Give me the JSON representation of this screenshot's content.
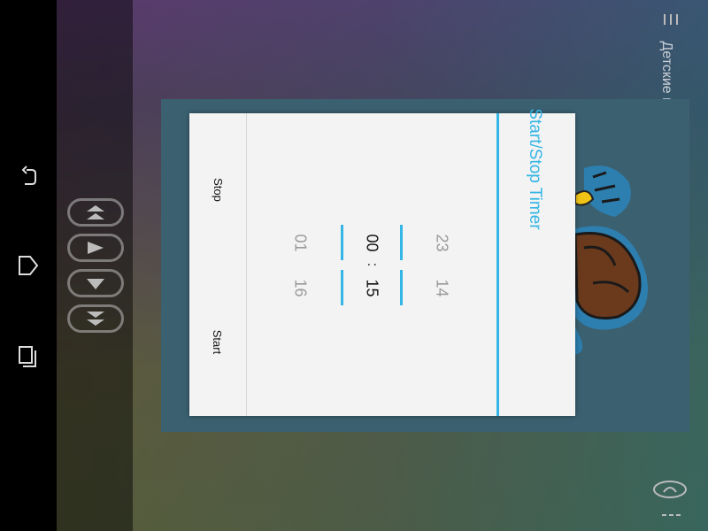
{
  "nav": {
    "back_icon": "back-icon",
    "home_icon": "home-icon",
    "recents_icon": "recent-apps-icon"
  },
  "app": {
    "title": "Детские песни",
    "controls": [
      "skip-previous-icon",
      "play-icon",
      "dropdown-icon",
      "skip-next-icon"
    ]
  },
  "dialog": {
    "title": "Start/Stop Timer",
    "stop_label": "Stop",
    "start_label": "Start",
    "picker": {
      "hours": {
        "prev": "23",
        "current": "00",
        "next": "01"
      },
      "minutes": {
        "prev": "14",
        "current": "15",
        "next": "16"
      },
      "separator": ":"
    }
  },
  "colors": {
    "accent": "#33b5e5",
    "dialog_bg": "#f3f3f3",
    "panel": "#3b6171"
  }
}
